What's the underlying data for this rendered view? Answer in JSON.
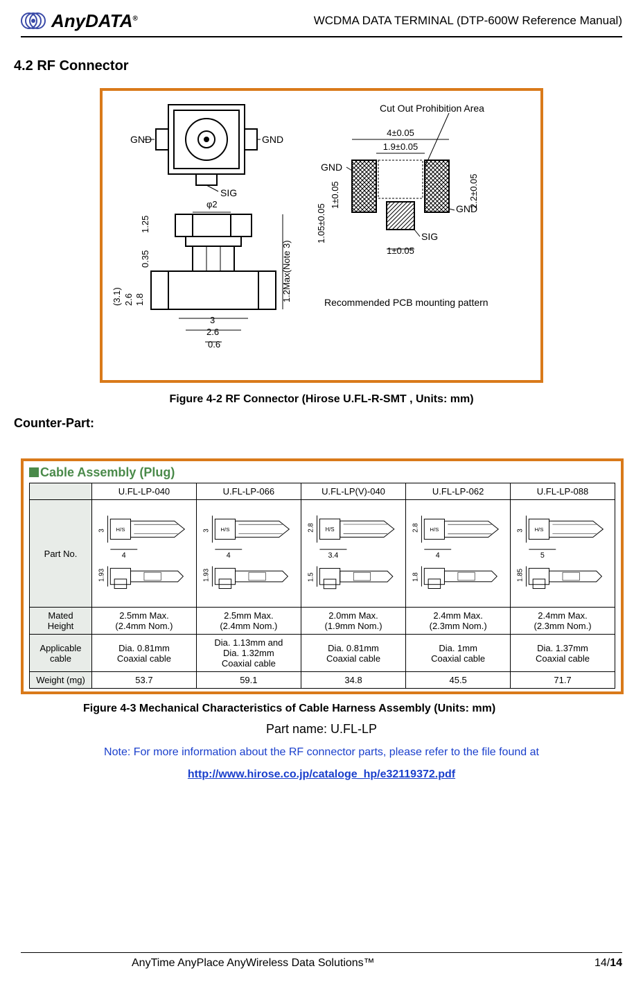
{
  "header": {
    "logo_text": "AnyDATA",
    "doc_title": "WCDMA DATA TERMINAL (DTP-600W Reference Manual)"
  },
  "section": {
    "heading": "4.2 RF Connector"
  },
  "figure1": {
    "caption": "Figure 4-2 RF Connector (Hirose U.FL-R-SMT , Units: mm)",
    "left": {
      "gnd_l": "GND",
      "gnd_r": "GND",
      "sig": "SIG",
      "phi2": "φ2",
      "d_1_25": "1.25",
      "d_0_35": "0.35",
      "d_3": "3",
      "d_2_6": "2.6",
      "d_0_6": "0.6",
      "d_3_1": "(3.1)",
      "d_2_6v": "2.6",
      "d_1_8": "1.8",
      "h_note": "1.2Max(Note 3)"
    },
    "right": {
      "cut_out": "Cut Out Prohibition Area",
      "d_4": "4±0.05",
      "d_1_9": "1.9±0.05",
      "gnd_l": "GND",
      "gnd_r": "GND",
      "sig": "SIG",
      "d_1v": "1±0.05",
      "d_1_05v": "1.05±0.05",
      "d_2_2v": "2.2±0.05",
      "d_1b": "1±0.05",
      "rec": "Recommended PCB mounting pattern"
    }
  },
  "counter_part": "Counter-Part:",
  "figure2": {
    "title": "Cable Assembly (Plug)",
    "caption": "Figure 4-3 Mechanical Characteristics of Cable Harness Assembly (Units: mm)",
    "row_headers": [
      "Part No.",
      "Mated Height",
      "Applicable cable",
      "Weight (mg)"
    ],
    "cols": [
      {
        "name": "U.FL-LP-040",
        "dims": {
          "h": "3",
          "hs": "H/S",
          "w": "4",
          "b": "1.93"
        },
        "mated": [
          "2.5mm Max.",
          "(2.4mm Nom.)"
        ],
        "cable": [
          "Dia. 0.81mm",
          "Coaxial cable"
        ],
        "weight": "53.7"
      },
      {
        "name": "U.FL-LP-066",
        "dims": {
          "h": "3",
          "hs": "H/S",
          "w": "4",
          "b": "1.93"
        },
        "mated": [
          "2.5mm Max.",
          "(2.4mm Nom.)"
        ],
        "cable": [
          "Dia. 1.13mm and",
          "Dia. 1.32mm",
          "Coaxial cable"
        ],
        "weight": "59.1"
      },
      {
        "name": "U.FL-LP(V)-040",
        "dims": {
          "h": "2.8",
          "hs": "H/S",
          "w": "3.4",
          "b": "1.5"
        },
        "mated": [
          "2.0mm Max.",
          "(1.9mm Nom.)"
        ],
        "cable": [
          "Dia. 0.81mm",
          "Coaxial cable"
        ],
        "weight": "34.8"
      },
      {
        "name": "U.FL-LP-062",
        "dims": {
          "h": "2.8",
          "hs": "H/S",
          "w": "4",
          "b": "1.8"
        },
        "mated": [
          "2.4mm Max.",
          "(2.3mm Nom.)"
        ],
        "cable": [
          "Dia. 1mm",
          "Coaxial cable"
        ],
        "weight": "45.5"
      },
      {
        "name": "U.FL-LP-088",
        "dims": {
          "h": "3",
          "hs": "H/S",
          "w": "5",
          "b": "1.85"
        },
        "mated": [
          "2.4mm Max.",
          "(2.3mm Nom.)"
        ],
        "cable": [
          "Dia. 1.37mm",
          "Coaxial cable"
        ],
        "weight": "71.7"
      }
    ]
  },
  "part_name_line": "Part name: U.FL-LP",
  "note_line": "Note: For more information about the RF connector parts, please refer to the file found at",
  "link_line": "http://www.hirose.co.jp/cataloge_hp/e32119372.pdf",
  "footer": {
    "tagline": "AnyTime AnyPlace AnyWireless Data Solutions™",
    "page_current": "14",
    "page_sep": "/",
    "page_total": "14"
  }
}
